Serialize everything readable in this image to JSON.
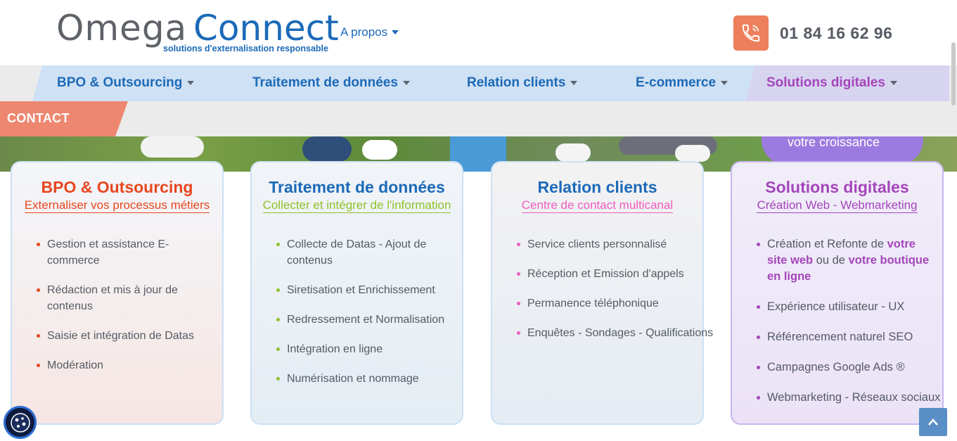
{
  "header": {
    "logo_omega": "Omega",
    "logo_connect": "Connect",
    "logo_tagline": "solutions d'externalisation responsable",
    "apropos_label": "A propos",
    "phone_number": "01 84 16 62 96",
    "phone_icon": "phone-icon"
  },
  "nav": {
    "items": [
      {
        "label": "BPO & Outsourcing"
      },
      {
        "label": "Traitement de données"
      },
      {
        "label": "Relation clients"
      },
      {
        "label": "E-commerce"
      },
      {
        "label": "Solutions digitales"
      }
    ],
    "contact_label": "CONTACT"
  },
  "hero": {
    "text": "votre croissance"
  },
  "cards": [
    {
      "title": "BPO & Outsourcing",
      "subtitle": "Externaliser vos processus métiers",
      "items": [
        "Gestion et assistance E-commerce",
        "Rédaction et mis à jour de contenus",
        "Saisie et intégration de Datas",
        "Modération"
      ]
    },
    {
      "title": "Traitement de données",
      "subtitle": "Collecter et intégrer de l'information",
      "items": [
        "Collecte de Datas - Ajout de contenus",
        "Siretisation et Enrichissement",
        "Redressement et Normalisation",
        "Intégration en ligne",
        "Numérisation et nommage"
      ]
    },
    {
      "title": "Relation clients",
      "subtitle": "Centre de contact multicanal",
      "items": [
        "Service clients personnalisé",
        "Réception et Emission d'appels",
        "Permanence téléphonique",
        "Enquêtes - Sondages - Qualifications"
      ]
    },
    {
      "title": "Solutions digitales",
      "subtitle": "Création Web - Webmarketing",
      "item0_part1": "Création et Refonte de ",
      "item0_bold1": "votre site web",
      "item0_part2": " ou de ",
      "item0_bold2": "votre boutique en ligne",
      "items": [
        "Expérience utilisateur - UX",
        "Référencement naturel SEO",
        "Campagnes Google Ads ®",
        "Webmarketing - Réseaux sociaux"
      ]
    }
  ],
  "colors": {
    "brand_blue": "#1c6ab8",
    "accent_orange": "#ee7f5c",
    "accent_red": "#e8461f",
    "accent_green": "#8fc02a",
    "accent_pink": "#ec5dbd",
    "accent_purple": "#a446bb"
  }
}
